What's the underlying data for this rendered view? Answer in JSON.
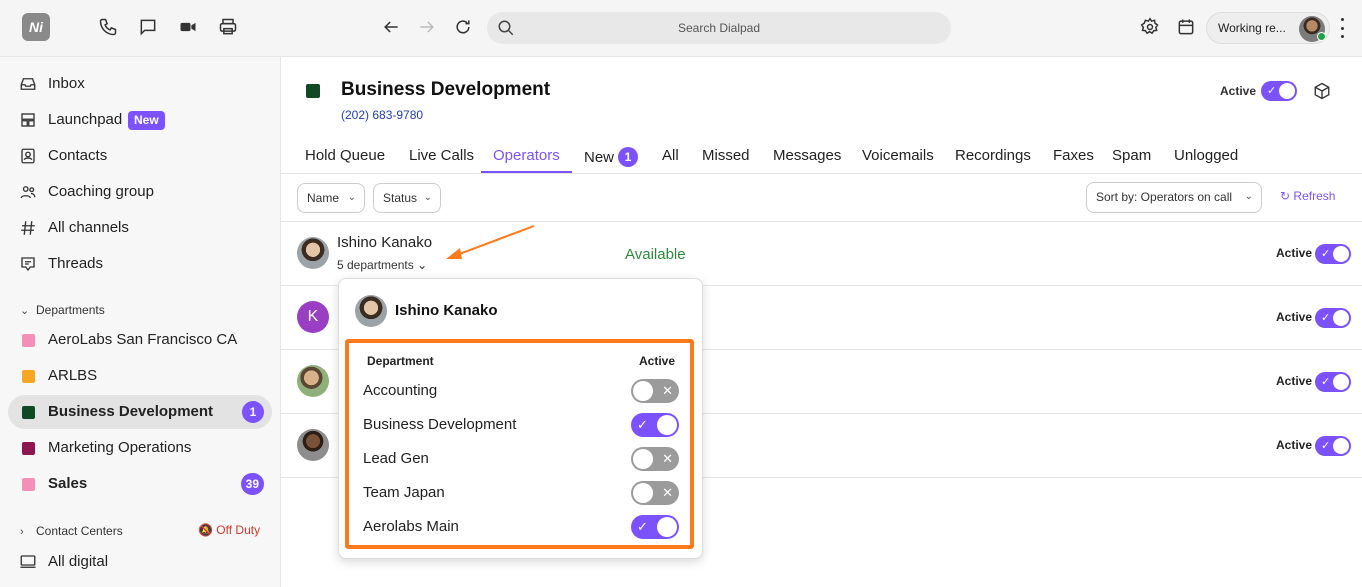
{
  "topbar": {
    "logo": "Ni",
    "search_placeholder": "Search Dialpad",
    "working_status": "Working re...",
    "icons": [
      "phone-icon",
      "message-icon",
      "video-icon",
      "printer-icon",
      "back-arrow-icon",
      "forward-arrow-icon",
      "refresh-icon",
      "search-icon",
      "gear-icon",
      "calendar-icon",
      "kebab-icon"
    ]
  },
  "sidebar": {
    "items": [
      {
        "label": "Inbox",
        "icon": "inbox-icon"
      },
      {
        "label": "Launchpad",
        "icon": "launchpad-icon",
        "badge": "New"
      },
      {
        "label": "Contacts",
        "icon": "contacts-icon"
      },
      {
        "label": "Coaching group",
        "icon": "group-icon"
      },
      {
        "label": "All channels",
        "icon": "hash-icon"
      },
      {
        "label": "Threads",
        "icon": "threads-icon"
      }
    ],
    "departments_header": "Departments",
    "departments": [
      {
        "label": "AeroLabs San Francisco CA",
        "color": "#f48fb8"
      },
      {
        "label": "ARLBS",
        "color": "#f5a623"
      },
      {
        "label": "Business Development",
        "color": "#0f4a25",
        "count": "1",
        "active": true
      },
      {
        "label": "Marketing Operations",
        "color": "#8e1650"
      },
      {
        "label": "Sales",
        "color": "#f48fb8",
        "count": "39"
      }
    ],
    "contact_centers_header": "Contact Centers",
    "off_duty": "Off Duty",
    "all_digital": "All digital"
  },
  "header": {
    "title": "Business Development",
    "phone": "(202) 683-9780",
    "active_label": "Active",
    "accent": "#7c52ff"
  },
  "tabs": [
    {
      "label": "Hold Queue"
    },
    {
      "label": "Live Calls"
    },
    {
      "label": "Operators",
      "selected": true
    },
    {
      "label": "New",
      "badge": "1"
    },
    {
      "label": "All"
    },
    {
      "label": "Missed"
    },
    {
      "label": "Messages"
    },
    {
      "label": "Voicemails"
    },
    {
      "label": "Recordings"
    },
    {
      "label": "Faxes"
    },
    {
      "label": "Spam"
    },
    {
      "label": "Unlogged"
    }
  ],
  "filters": {
    "name": "Name",
    "status": "Status",
    "sort": "Sort by: Operators on call",
    "refresh": "Refresh"
  },
  "operators": [
    {
      "name": "Ishino Kanako",
      "departments": "5 departments",
      "status": "Available",
      "active_label": "Active"
    },
    {
      "initial": "K",
      "active_label": "Active"
    },
    {
      "active_label": "Active"
    },
    {
      "active_label": "Active"
    }
  ],
  "popover": {
    "name": "Ishino Kanako",
    "col_department": "Department",
    "col_active": "Active",
    "departments": [
      {
        "label": "Accounting",
        "active": false
      },
      {
        "label": "Business Development",
        "active": true
      },
      {
        "label": "Lead Gen",
        "active": false
      },
      {
        "label": "Team Japan",
        "active": false
      },
      {
        "label": "Aerolabs Main",
        "active": true
      }
    ]
  }
}
